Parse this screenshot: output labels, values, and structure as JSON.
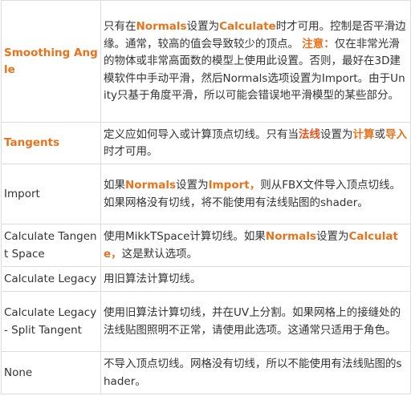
{
  "rows": [
    {
      "name": "Smoothing Angle",
      "emphasis": true,
      "desc": [
        {
          "t": "只有在"
        },
        {
          "t": "Normals",
          "hl": true
        },
        {
          "t": "设置为"
        },
        {
          "t": "Calculate",
          "hl": true
        },
        {
          "t": "时才可用。控制是否平滑边缘。通常，较高的值会导致较少的顶点。 "
        },
        {
          "t": "注意：",
          "hl": true
        },
        {
          "t": "仅在非常光滑的物体或非常高面数的模型上使用此设置。否则，最好在3D建模软件中手动平滑，然后Normals选项设置为Import。由于Unity只基于角度平滑，所以可能会错误地平滑模型的某些部分。"
        }
      ]
    },
    {
      "name": "Tangents",
      "emphasis": true,
      "desc": [
        {
          "t": "定义应如何导入或计算顶点切线。只有当"
        },
        {
          "t": "法线",
          "hl": true,
          "red": true
        },
        {
          "t": "设置为"
        },
        {
          "t": "计算",
          "hl": true
        },
        {
          "t": "或"
        },
        {
          "t": "导入",
          "hl": true
        },
        {
          "t": "时才可用。"
        }
      ]
    },
    {
      "name": "Import",
      "emphasis": false,
      "desc": [
        {
          "t": "如果"
        },
        {
          "t": "Normals",
          "hl": true
        },
        {
          "t": "设置为"
        },
        {
          "t": "Import，",
          "hl": true
        },
        {
          "t": "则从FBX文件导入顶点切线。如果网格没有切线，将不能使用有法线贴图的shader。"
        }
      ]
    },
    {
      "name": "Calculate Tangent Space",
      "emphasis": false,
      "desc": [
        {
          "t": "使用MikkTSpace计算切线。如果"
        },
        {
          "t": "Normals",
          "hl": true
        },
        {
          "t": "设置为"
        },
        {
          "t": "Calculate，",
          "hl": true
        },
        {
          "t": "这是默认选项。"
        }
      ]
    },
    {
      "name": "Calculate Legacy",
      "emphasis": false,
      "desc": [
        {
          "t": "用旧算法计算切线。"
        }
      ]
    },
    {
      "name": "Calculate Legacy - Split Tangent",
      "emphasis": false,
      "desc": [
        {
          "t": "使用旧算法计算切线，并在UV上分割。如果网格上的接缝处的法线贴图照明不正常，请使用此选项。这通常只适用于角色。"
        }
      ]
    },
    {
      "name": "None",
      "emphasis": false,
      "desc": [
        {
          "t": "不导入顶点切线。网格没有切线，所以不能使用有法线贴图的shader。"
        }
      ]
    }
  ],
  "colors": {
    "accent": "#e8731d",
    "accent_red": "#e8521f",
    "text": "#333333",
    "border": "#dcdcdc"
  }
}
